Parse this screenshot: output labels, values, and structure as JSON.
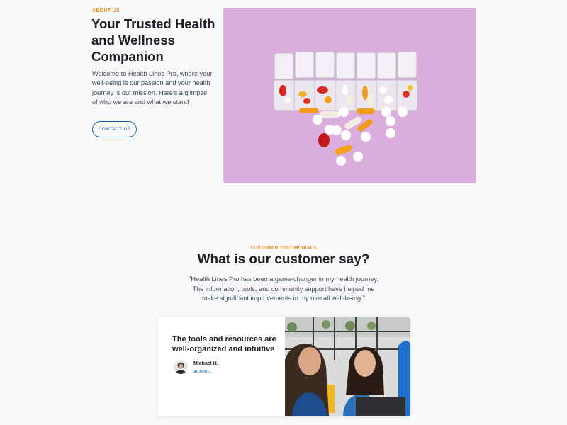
{
  "about": {
    "eyebrow": "ABOUT US",
    "title": "Your Trusted Health and Wellness Companion",
    "body": "Welcome to Health Lines Pro, where your well-being is our passion and your health journey is our mission. Here's a glimpse of who we are and what we stand",
    "cta_label": "CONTACT US",
    "image_icon": "pill-organizer-photo"
  },
  "testimonials": {
    "eyebrow": "CUSTOMER TESTIMONIALS",
    "title": "What is our customer say?",
    "quote": "\"Health Lines Pro has been a game-changer in my health journey. The information, tools, and community support have helped me make significant improvements in my overall well-being.\"",
    "card": {
      "title": "The tools and resources are well-organized and intuitive",
      "author_name": "Michael H.",
      "author_role": "architect",
      "image_icon": "women-meeting-photo"
    }
  },
  "colors": {
    "accent_orange": "#e88a1a",
    "brand_blue": "#1e5fa3",
    "hero_background": "#dcaede",
    "page_background": "#f8f9fa"
  }
}
